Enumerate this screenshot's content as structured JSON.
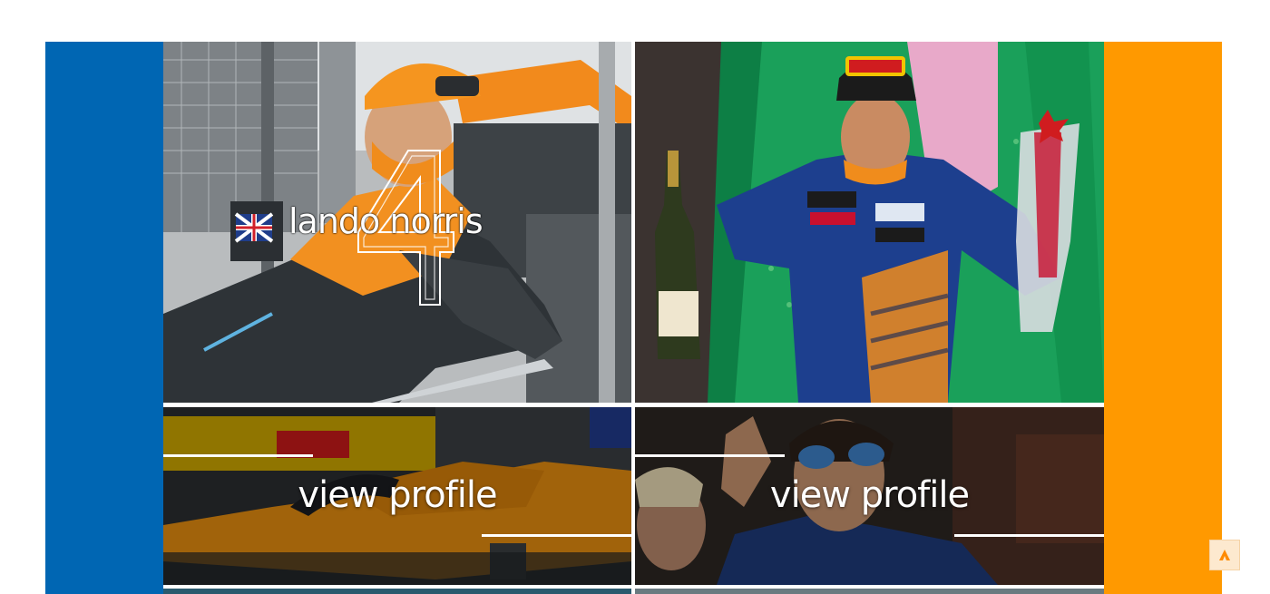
{
  "colors": {
    "left_bar": "#0066b3",
    "right_bar": "#ff9900",
    "accent_orange": "#ff8000",
    "scroll_button_icon": "#ff8a00"
  },
  "drivers": [
    {
      "name": "lando norris",
      "number": "4",
      "profile_label": "view profile"
    },
    {
      "profile_label": "view profile"
    }
  ],
  "scroll_top": {
    "icon": "chevron-up-icon"
  }
}
